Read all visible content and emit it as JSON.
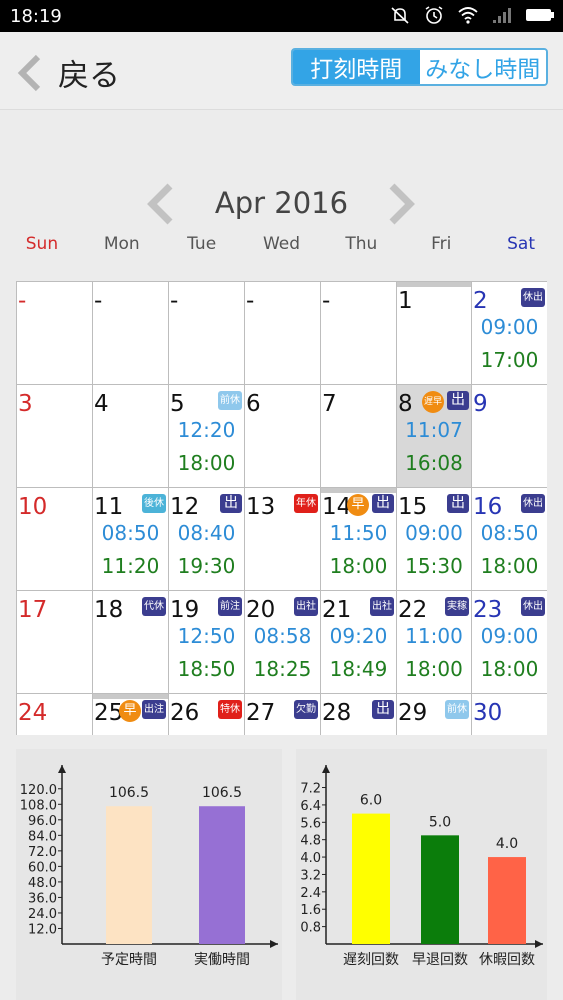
{
  "status": {
    "time": "18:19"
  },
  "header": {
    "back_label": "戻る",
    "seg_items": [
      "打刻時間",
      "みなし時間"
    ],
    "seg_active": 0
  },
  "calendar": {
    "month_title": "Apr 2016",
    "weekdays": [
      "Sun",
      "Mon",
      "Tue",
      "Wed",
      "Thu",
      "Fri",
      "Sat"
    ],
    "colors": {
      "sun": "#d42a2a",
      "sat": "#2735b4",
      "in_time": "#2d8cd6",
      "out_time": "#1f7e1f"
    },
    "days": [
      {
        "label": "-",
        "kind": "sun"
      },
      {
        "label": "-"
      },
      {
        "label": "-"
      },
      {
        "label": "-"
      },
      {
        "label": "-"
      },
      {
        "label": "1",
        "topbar": true
      },
      {
        "label": "2",
        "kind": "sat",
        "in": "09:00",
        "out": "17:00",
        "badge": {
          "text": "休出",
          "color": "navy"
        }
      },
      {
        "label": "3",
        "kind": "sun"
      },
      {
        "label": "4"
      },
      {
        "label": "5",
        "in": "12:20",
        "out": "18:00",
        "badge": {
          "text": "前休",
          "color": "light"
        }
      },
      {
        "label": "6"
      },
      {
        "label": "7"
      },
      {
        "label": "8",
        "gray": true,
        "in": "11:07",
        "out": "16:08",
        "badge": {
          "text": "出",
          "color": "navy"
        },
        "circle": {
          "text": "遅早"
        }
      },
      {
        "label": "9",
        "kind": "sat"
      },
      {
        "label": "10",
        "kind": "sun"
      },
      {
        "label": "11",
        "in": "08:50",
        "out": "11:20",
        "badge": {
          "text": "後休",
          "color": "teal"
        }
      },
      {
        "label": "12",
        "in": "08:40",
        "out": "19:30",
        "badge": {
          "text": "出",
          "color": "navy"
        }
      },
      {
        "label": "13",
        "badge": {
          "text": "年休",
          "color": "red"
        }
      },
      {
        "label": "14",
        "topbar": true,
        "in": "11:50",
        "out": "18:00",
        "badge": {
          "text": "出",
          "color": "navy"
        },
        "circle": {
          "text": "早"
        }
      },
      {
        "label": "15",
        "in": "09:00",
        "out": "15:30",
        "badge": {
          "text": "出",
          "color": "navy"
        }
      },
      {
        "label": "16",
        "kind": "sat",
        "in": "08:50",
        "out": "18:00",
        "badge": {
          "text": "休出",
          "color": "navy"
        }
      },
      {
        "label": "17",
        "kind": "sun"
      },
      {
        "label": "18",
        "badge": {
          "text": "代休",
          "color": "navy"
        }
      },
      {
        "label": "19",
        "in": "12:50",
        "out": "18:50",
        "badge": {
          "text": "前注",
          "color": "navy"
        }
      },
      {
        "label": "20",
        "in": "08:58",
        "out": "18:25",
        "badge": {
          "text": "出社",
          "color": "navy"
        }
      },
      {
        "label": "21",
        "in": "09:20",
        "out": "18:49",
        "badge": {
          "text": "出社",
          "color": "navy"
        }
      },
      {
        "label": "22",
        "in": "11:00",
        "out": "18:00",
        "badge": {
          "text": "実稼",
          "color": "navy"
        }
      },
      {
        "label": "23",
        "kind": "sat",
        "in": "09:00",
        "out": "18:00",
        "badge": {
          "text": "休出",
          "color": "navy"
        }
      },
      {
        "label": "24",
        "kind": "sun"
      },
      {
        "label": "25",
        "topbar": true,
        "badge": {
          "text": "出注",
          "color": "navy"
        },
        "circle": {
          "text": "早"
        }
      },
      {
        "label": "26",
        "badge": {
          "text": "特休",
          "color": "red"
        }
      },
      {
        "label": "27",
        "badge": {
          "text": "欠勤",
          "color": "navy"
        }
      },
      {
        "label": "28",
        "badge": {
          "text": "出",
          "color": "navy"
        }
      },
      {
        "label": "29",
        "badge": {
          "text": "前休",
          "color": "light"
        }
      },
      {
        "label": "30",
        "kind": "sat"
      }
    ]
  },
  "chart_data": [
    {
      "type": "bar",
      "categories": [
        "予定時間",
        "実働時間"
      ],
      "values": [
        106.5,
        106.5
      ],
      "colors": [
        "#fde3c3",
        "#9670d4"
      ],
      "value_labels": [
        "106.5",
        "106.5"
      ],
      "yticks": [
        "12.0",
        "24.0",
        "36.0",
        "48.0",
        "60.0",
        "72.0",
        "84.0",
        "96.0",
        "108.0",
        "120.0"
      ],
      "ylim": [
        0,
        126
      ]
    },
    {
      "type": "bar",
      "categories": [
        "遅刻回数",
        "早退回数",
        "休暇回数"
      ],
      "values": [
        6.0,
        5.0,
        4.0
      ],
      "colors": [
        "#ffff00",
        "#0b7d0b",
        "#ff6347"
      ],
      "value_labels": [
        "6.0",
        "5.0",
        "4.0"
      ],
      "yticks": [
        "0.8",
        "1.6",
        "2.4",
        "3.2",
        "4.0",
        "4.8",
        "5.6",
        "6.4",
        "7.2"
      ],
      "ylim": [
        0,
        7.5
      ]
    }
  ]
}
